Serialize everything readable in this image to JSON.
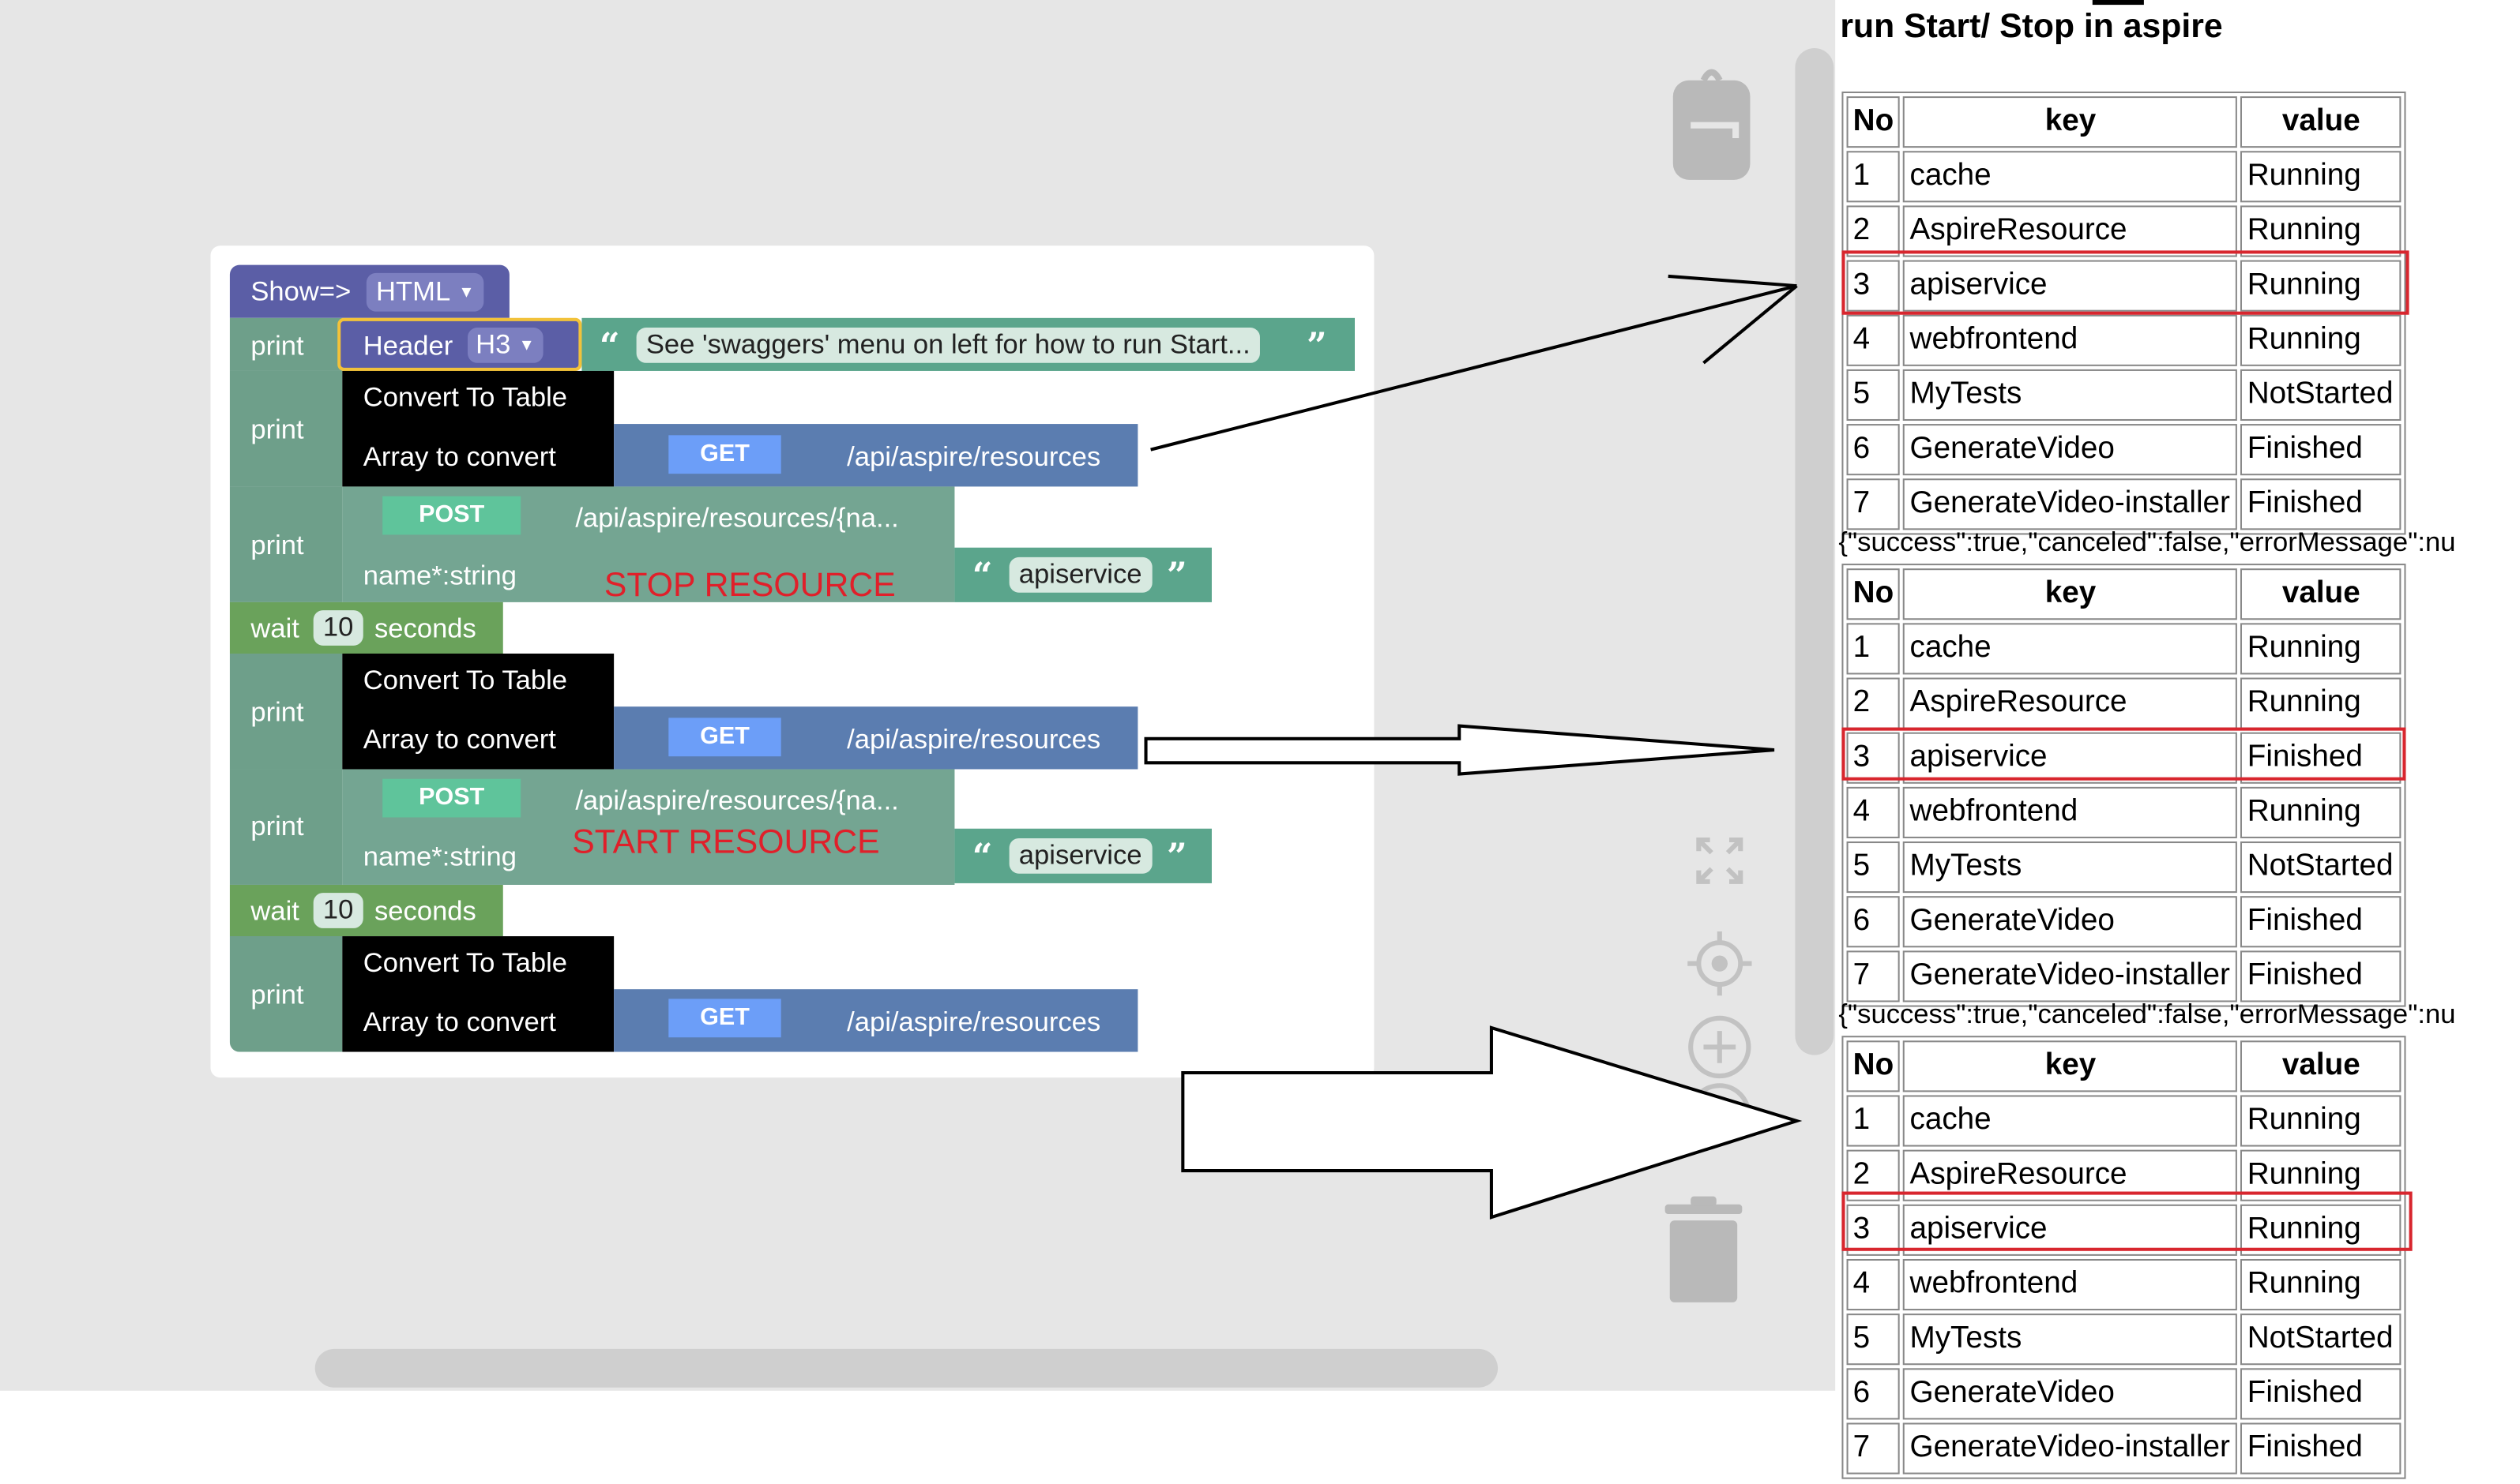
{
  "workspace": {
    "show_block": {
      "label": "Show=>",
      "format": "HTML"
    },
    "print_label": "print",
    "header_block": {
      "label": "Header",
      "level": "H3",
      "text": "See 'swaggers' menu on left for how to run Start..."
    },
    "convert_label": "Convert To Table",
    "array_label": "Array to convert",
    "get_method": "GET",
    "get_path": "/api/aspire/resources",
    "post_method": "POST",
    "post_path": "/api/aspire/resources/{na...",
    "name_param": "name*:string",
    "name_value": "apiservice",
    "wait": {
      "label": "wait",
      "value": "10",
      "unit": "seconds"
    },
    "annotation_stop": "STOP RESOURCE",
    "annotation_start": "START RESOURCE"
  },
  "output": {
    "title_partial": "run Start/ Stop in aspire",
    "json_line": "{\"success\":true,\"canceled\":false,\"errorMessage\":nu",
    "headers": {
      "no": "No",
      "key": "key",
      "value": "value"
    },
    "tables": [
      {
        "rows": [
          {
            "no": "1",
            "key": "cache",
            "value": "Running"
          },
          {
            "no": "2",
            "key": "AspireResource",
            "value": "Running"
          },
          {
            "no": "3",
            "key": "apiservice",
            "value": "Running"
          },
          {
            "no": "4",
            "key": "webfrontend",
            "value": "Running"
          },
          {
            "no": "5",
            "key": "MyTests",
            "value": "NotStarted"
          },
          {
            "no": "6",
            "key": "GenerateVideo",
            "value": "Finished"
          },
          {
            "no": "7",
            "key": "GenerateVideo-installer",
            "value": "Finished"
          }
        ]
      },
      {
        "rows": [
          {
            "no": "1",
            "key": "cache",
            "value": "Running"
          },
          {
            "no": "2",
            "key": "AspireResource",
            "value": "Running"
          },
          {
            "no": "3",
            "key": "apiservice",
            "value": "Finished"
          },
          {
            "no": "4",
            "key": "webfrontend",
            "value": "Running"
          },
          {
            "no": "5",
            "key": "MyTests",
            "value": "NotStarted"
          },
          {
            "no": "6",
            "key": "GenerateVideo",
            "value": "Finished"
          },
          {
            "no": "7",
            "key": "GenerateVideo-installer",
            "value": "Finished"
          }
        ]
      },
      {
        "rows": [
          {
            "no": "1",
            "key": "cache",
            "value": "Running"
          },
          {
            "no": "2",
            "key": "AspireResource",
            "value": "Running"
          },
          {
            "no": "3",
            "key": "apiservice",
            "value": "Running"
          },
          {
            "no": "4",
            "key": "webfrontend",
            "value": "Running"
          },
          {
            "no": "5",
            "key": "MyTests",
            "value": "NotStarted"
          },
          {
            "no": "6",
            "key": "GenerateVideo",
            "value": "Finished"
          },
          {
            "no": "7",
            "key": "GenerateVideo-installer",
            "value": "Finished"
          }
        ]
      }
    ]
  },
  "icons": {
    "backpack": "backpack-icon",
    "fullscreen": "fullscreen-icon",
    "recenter": "target-icon",
    "zoom_in": "zoom-in-icon",
    "zoom_out": "zoom-out-icon",
    "trash": "trash-icon"
  },
  "colors": {
    "show_block": "#5b5ea6",
    "print_block": "#6e9f8a",
    "header_block": "#5b5ea6",
    "text_block": "#5ba58c",
    "convert_block": "#000000",
    "get_block": "#5b7db0",
    "get_badge": "#6c9ef8",
    "post_badge": "#5fc49b",
    "wait_block": "#6aa25b",
    "highlight": "#d8262e"
  }
}
